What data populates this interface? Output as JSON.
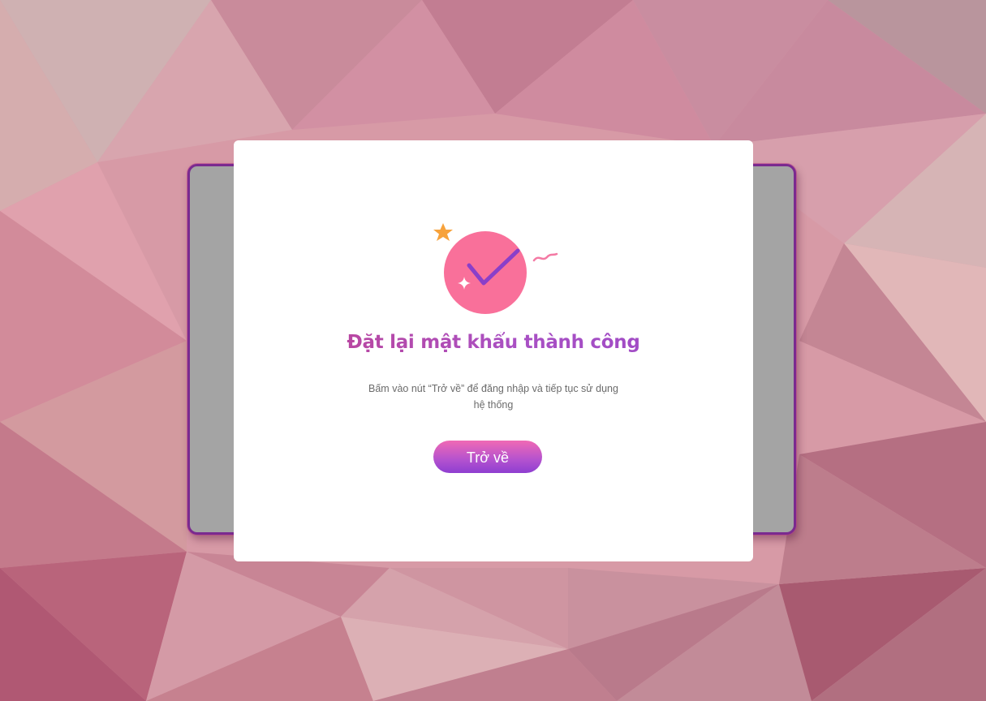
{
  "modal": {
    "title": "Đặt lại mật khẩu thành công",
    "description": "Bấm vào nút “Trở về” để đăng nhập và tiếp tục sử dụng hệ thống",
    "button_label": "Trở về"
  },
  "illustration": {
    "icons": [
      "check-circle-icon",
      "star-icon",
      "sparkle-icon",
      "squiggle-icon"
    ]
  },
  "colors": {
    "circle": "#f9709a",
    "check": "#8a3fc9",
    "star": "#f7a23b",
    "accent_title": "#b04bb7",
    "button_top": "#f06ab4",
    "button_bottom": "#8e3ed0",
    "backdrop_card": "#a4a4a4",
    "backdrop_border": "#7a2a8f"
  }
}
